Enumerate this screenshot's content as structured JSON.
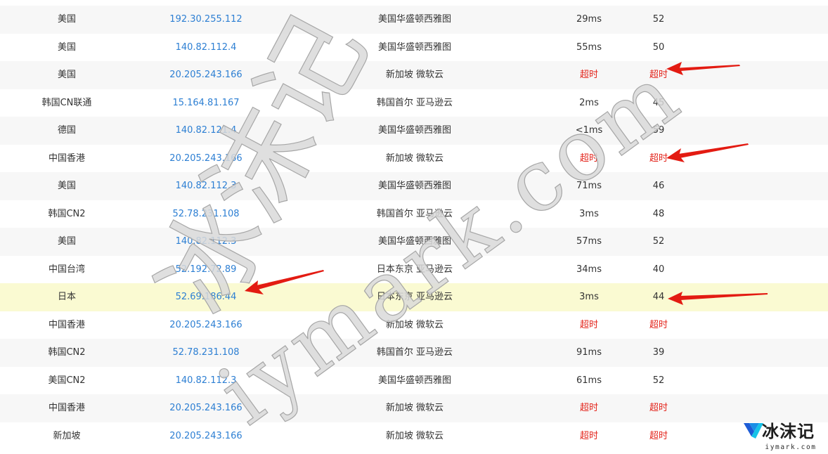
{
  "results": [
    {
      "region": "美国",
      "ip": "192.30.255.112",
      "node": "美国华盛顿西雅图",
      "latency": "29ms",
      "ttl": "52",
      "timeout": false
    },
    {
      "region": "美国",
      "ip": "140.82.112.4",
      "node": "美国华盛顿西雅图",
      "latency": "55ms",
      "ttl": "50",
      "timeout": false
    },
    {
      "region": "美国",
      "ip": "20.205.243.166",
      "node": "新加坡 微软云",
      "latency": "超时",
      "ttl": "超时",
      "timeout": true
    },
    {
      "region": "韩国CN联通",
      "ip": "15.164.81.167",
      "node": "韩国首尔 亚马逊云",
      "latency": "2ms",
      "ttl": "45",
      "timeout": false
    },
    {
      "region": "德国",
      "ip": "140.82.121.4",
      "node": "美国华盛顿西雅图",
      "latency": "<1ms",
      "ttl": "59",
      "timeout": false
    },
    {
      "region": "中国香港",
      "ip": "20.205.243.166",
      "node": "新加坡 微软云",
      "latency": "超时",
      "ttl": "超时",
      "timeout": true
    },
    {
      "region": "美国",
      "ip": "140.82.112.3",
      "node": "美国华盛顿西雅图",
      "latency": "71ms",
      "ttl": "46",
      "timeout": false
    },
    {
      "region": "韩国CN2",
      "ip": "52.78.231.108",
      "node": "韩国首尔 亚马逊云",
      "latency": "3ms",
      "ttl": "48",
      "timeout": false
    },
    {
      "region": "美国",
      "ip": "140.82.112.3",
      "node": "美国华盛顿西雅图",
      "latency": "57ms",
      "ttl": "52",
      "timeout": false
    },
    {
      "region": "中国台湾",
      "ip": "52.192.72.89",
      "node": "日本东京 亚马逊云",
      "latency": "34ms",
      "ttl": "40",
      "timeout": false
    },
    {
      "region": "日本",
      "ip": "52.69.186.44",
      "node": "日本东京 亚马逊云",
      "latency": "3ms",
      "ttl": "44",
      "timeout": false,
      "highlight": true
    },
    {
      "region": "中国香港",
      "ip": "20.205.243.166",
      "node": "新加坡 微软云",
      "latency": "超时",
      "ttl": "超时",
      "timeout": true
    },
    {
      "region": "韩国CN2",
      "ip": "52.78.231.108",
      "node": "韩国首尔 亚马逊云",
      "latency": "91ms",
      "ttl": "39",
      "timeout": false
    },
    {
      "region": "美国CN2",
      "ip": "140.82.112.3",
      "node": "美国华盛顿西雅图",
      "latency": "61ms",
      "ttl": "52",
      "timeout": false
    },
    {
      "region": "中国香港",
      "ip": "20.205.243.166",
      "node": "新加坡 微软云",
      "latency": "超时",
      "ttl": "超时",
      "timeout": true
    },
    {
      "region": "新加坡",
      "ip": "20.205.243.166",
      "node": "新加坡 微软云",
      "latency": "超时",
      "ttl": "超时",
      "timeout": true
    }
  ],
  "watermark": {
    "line1": "冰沫记",
    "line2": "iymark.com"
  },
  "logo": {
    "name": "冰沫记",
    "domain": "iymark.com"
  },
  "colors": {
    "link": "#2d7fd3",
    "timeout": "#e3241b",
    "arrow": "#e31b12",
    "highlight_row": "#fafad2",
    "stripe_row": "#f7f7f7"
  }
}
